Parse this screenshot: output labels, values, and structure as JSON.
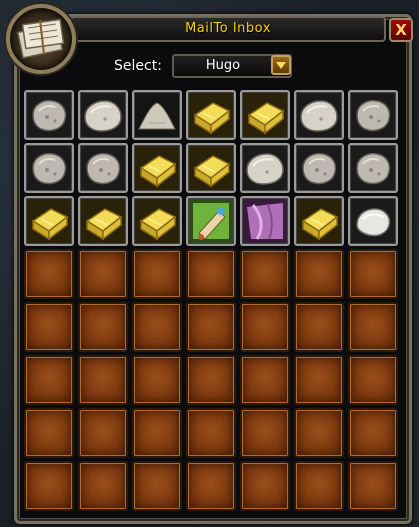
{
  "window": {
    "title": "MailTo  Inbox",
    "close_label": "X"
  },
  "selector": {
    "label": "Select:",
    "value": "Hugo"
  },
  "colors": {
    "title": "#f7d10a",
    "empty_slot": "#7e3a10"
  },
  "inventory": {
    "columns": 7,
    "rows": 8,
    "slots": [
      "stone",
      "stone-light",
      "powder",
      "gold-bar",
      "gold-bar",
      "stone-light",
      "stone",
      "stone",
      "stone",
      "gold-bar",
      "gold-bar",
      "stone-light",
      "stone",
      "stone",
      "gold-bar",
      "gold-bar",
      "gold-bar",
      "scroll-green",
      "cloth-purple",
      "gold-bar",
      "stone-white",
      "empty",
      "empty",
      "empty",
      "empty",
      "empty",
      "empty",
      "empty",
      "empty",
      "empty",
      "empty",
      "empty",
      "empty",
      "empty",
      "empty",
      "empty",
      "empty",
      "empty",
      "empty",
      "empty",
      "empty",
      "empty",
      "empty",
      "empty",
      "empty",
      "empty",
      "empty",
      "empty",
      "empty",
      "empty",
      "empty",
      "empty",
      "empty",
      "empty",
      "empty",
      "empty"
    ]
  }
}
